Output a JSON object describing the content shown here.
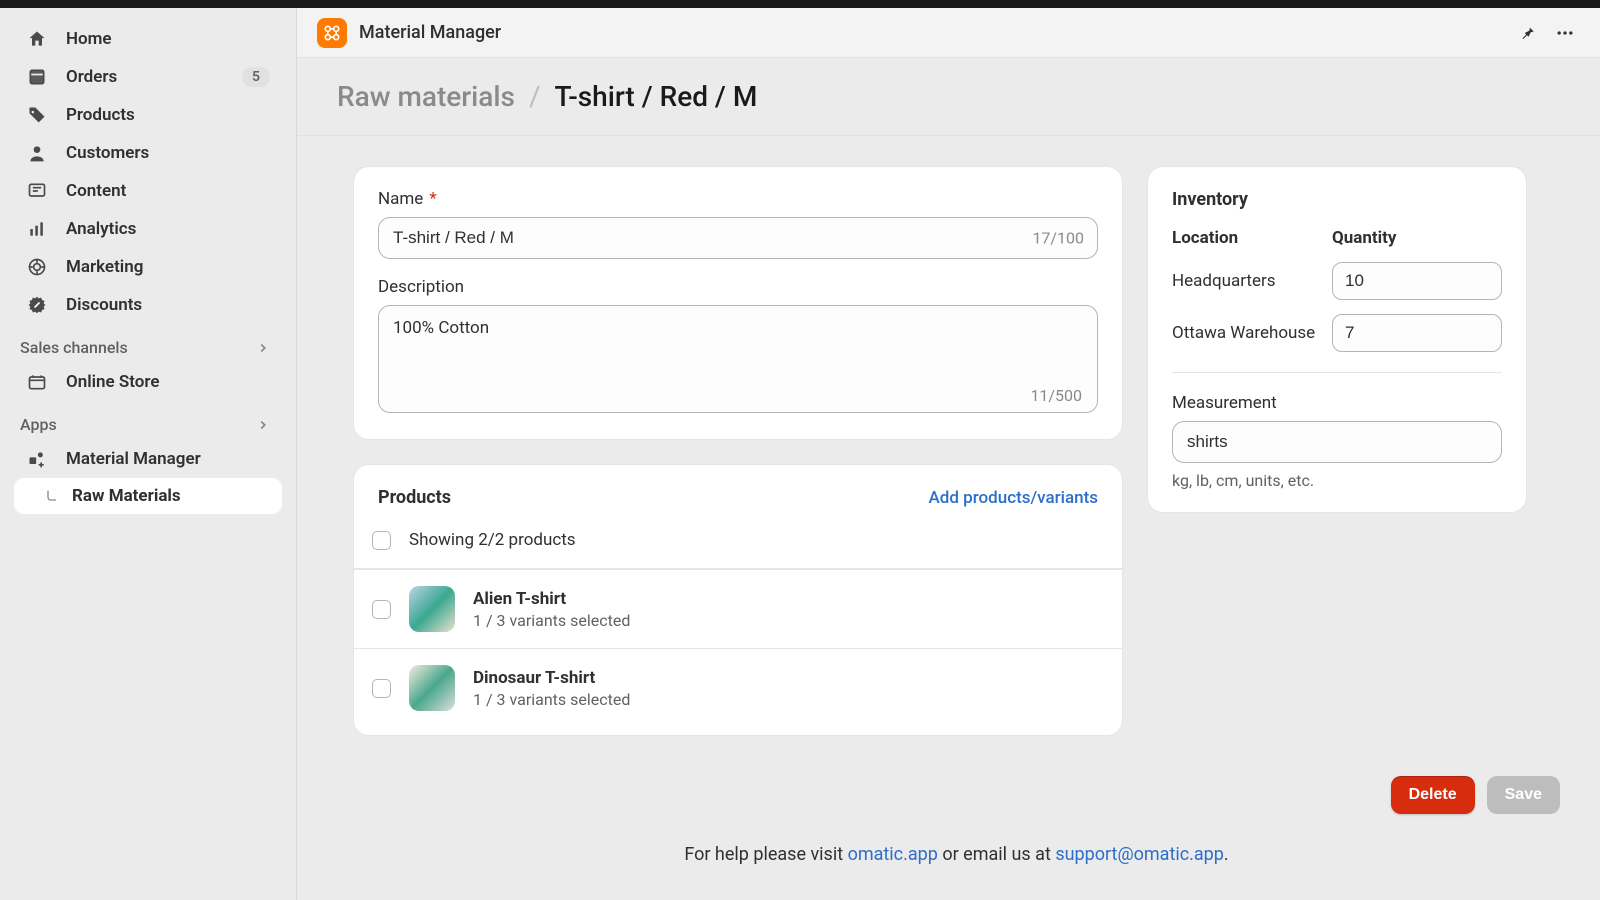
{
  "sidebar": {
    "items": [
      {
        "label": "Home",
        "icon": "home-icon"
      },
      {
        "label": "Orders",
        "icon": "orders-icon",
        "badge": "5"
      },
      {
        "label": "Products",
        "icon": "products-icon"
      },
      {
        "label": "Customers",
        "icon": "customers-icon"
      },
      {
        "label": "Content",
        "icon": "content-icon"
      },
      {
        "label": "Analytics",
        "icon": "analytics-icon"
      },
      {
        "label": "Marketing",
        "icon": "marketing-icon"
      },
      {
        "label": "Discounts",
        "icon": "discounts-icon"
      }
    ],
    "sales_channels_label": "Sales channels",
    "online_store_label": "Online Store",
    "apps_label": "Apps",
    "material_manager_label": "Material Manager",
    "raw_materials_label": "Raw Materials"
  },
  "header": {
    "app_name": "Material Manager"
  },
  "breadcrumb": {
    "root": "Raw materials",
    "separator": "/",
    "current": "T-shirt / Red / M"
  },
  "form": {
    "name_label": "Name",
    "name_value": "T-shirt / Red / M",
    "name_counter": "17/100",
    "description_label": "Description",
    "description_value": "100% Cotton",
    "description_counter": "11/500"
  },
  "products": {
    "heading": "Products",
    "add_link": "Add products/variants",
    "showing_text": "Showing 2/2 products",
    "rows": [
      {
        "title": "Alien T-shirt",
        "sub": "1 / 3 variants selected"
      },
      {
        "title": "Dinosaur T-shirt",
        "sub": "1 / 3 variants selected"
      }
    ]
  },
  "inventory": {
    "heading": "Inventory",
    "location_col": "Location",
    "quantity_col": "Quantity",
    "rows": [
      {
        "location": "Headquarters",
        "quantity": "10"
      },
      {
        "location": "Ottawa Warehouse",
        "quantity": "7"
      }
    ],
    "measurement_label": "Measurement",
    "measurement_value": "shirts",
    "measurement_help": "kg, lb, cm, units, etc."
  },
  "actions": {
    "delete_label": "Delete",
    "save_label": "Save"
  },
  "footer_help": {
    "prefix": "For help please visit ",
    "link1": "omatic.app",
    "mid": " or email us at ",
    "link2": "support@omatic.app",
    "suffix": "."
  }
}
